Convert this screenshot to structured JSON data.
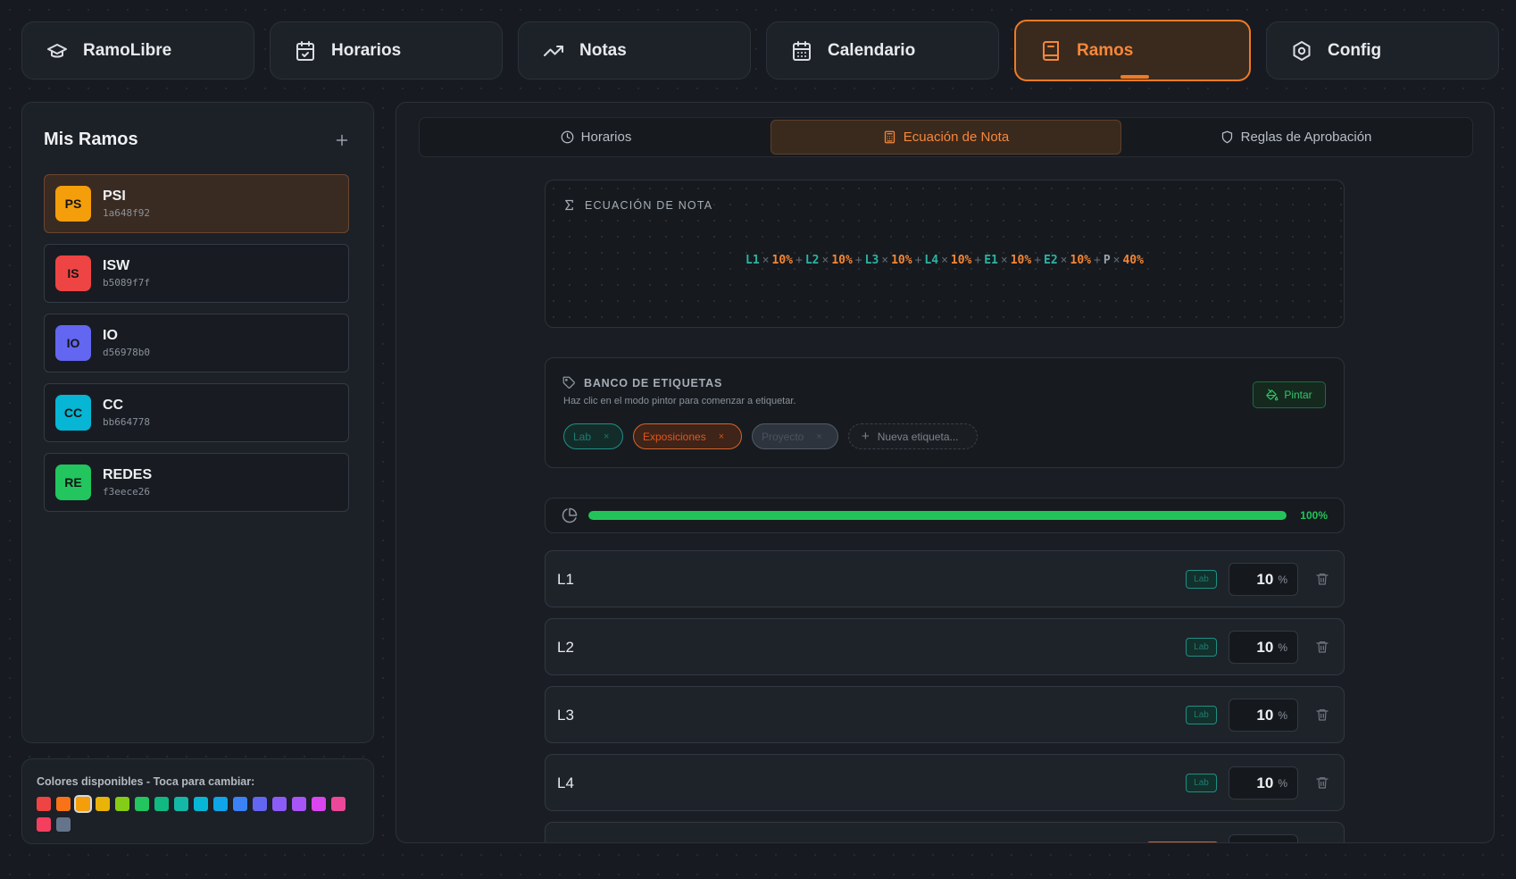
{
  "nav": {
    "tabs": [
      {
        "label": "RamoLibre",
        "icon": "graduation-cap-icon"
      },
      {
        "label": "Horarios",
        "icon": "calendar-check-icon"
      },
      {
        "label": "Notas",
        "icon": "trending-up-icon"
      },
      {
        "label": "Calendario",
        "icon": "calendar-icon"
      },
      {
        "label": "Ramos",
        "icon": "book-icon",
        "active": true
      },
      {
        "label": "Config",
        "icon": "settings-icon"
      }
    ]
  },
  "sidebar": {
    "title": "Mis Ramos",
    "add_label": "+",
    "courses": [
      {
        "abbr": "PS",
        "name": "PSI",
        "id": "1a648f92",
        "color": "#f59e0b",
        "selected": true
      },
      {
        "abbr": "IS",
        "name": "ISW",
        "id": "b5089f7f",
        "color": "#ef4444"
      },
      {
        "abbr": "IO",
        "name": "IO",
        "id": "d56978b0",
        "color": "#6366f1"
      },
      {
        "abbr": "CC",
        "name": "CC",
        "id": "bb664778",
        "color": "#06b6d4"
      },
      {
        "abbr": "RE",
        "name": "REDES",
        "id": "f3eece26",
        "color": "#22c55e"
      }
    ]
  },
  "palette": {
    "title": "Colores disponibles - Toca para cambiar:",
    "colors": [
      "#ef4444",
      "#f97316",
      "#f59e0b",
      "#eab308",
      "#84cc16",
      "#22c55e",
      "#10b981",
      "#14b8a6",
      "#06b6d4",
      "#0ea5e9",
      "#3b82f6",
      "#6366f1",
      "#8b5cf6",
      "#a855f7",
      "#d946ef",
      "#ec4899",
      "#f43f5e",
      "#64748b"
    ],
    "selected_index": 2
  },
  "subtabs": [
    {
      "label": "Horarios",
      "icon": "clock-icon"
    },
    {
      "label": "Ecuación de Nota",
      "icon": "calculator-icon",
      "active": true
    },
    {
      "label": "Reglas de Aprobación",
      "icon": "shield-icon"
    }
  ],
  "equation": {
    "title": "ECUACIÓN DE NOTA",
    "times": "×",
    "plus": "+",
    "terms": [
      {
        "var": "L1",
        "weight": "10%"
      },
      {
        "var": "L2",
        "weight": "10%"
      },
      {
        "var": "L3",
        "weight": "10%"
      },
      {
        "var": "L4",
        "weight": "10%"
      },
      {
        "var": "E1",
        "weight": "10%"
      },
      {
        "var": "E2",
        "weight": "10%"
      },
      {
        "var": "P",
        "weight": "40%"
      }
    ]
  },
  "tag_bank": {
    "title": "BANCO DE ETIQUETAS",
    "subtitle": "Haz clic en el modo pintor para comenzar a etiquetar.",
    "paint_label": "Pintar",
    "tags": [
      {
        "label": "Lab",
        "style": "lab"
      },
      {
        "label": "Exposiciones",
        "style": "exp"
      },
      {
        "label": "Proyecto",
        "style": "pro"
      }
    ],
    "remove_symbol": "×",
    "new_placeholder": "Nueva etiqueta...",
    "new_plus": "+"
  },
  "progress": {
    "value": 100,
    "label": "100%"
  },
  "items": [
    {
      "name": "L1",
      "tag": "Lab",
      "weight": "10",
      "unit": "%"
    },
    {
      "name": "L2",
      "tag": "Lab",
      "weight": "10",
      "unit": "%"
    },
    {
      "name": "L3",
      "tag": "Lab",
      "weight": "10",
      "unit": "%"
    },
    {
      "name": "L4",
      "tag": "Lab",
      "weight": "10",
      "unit": "%"
    }
  ]
}
